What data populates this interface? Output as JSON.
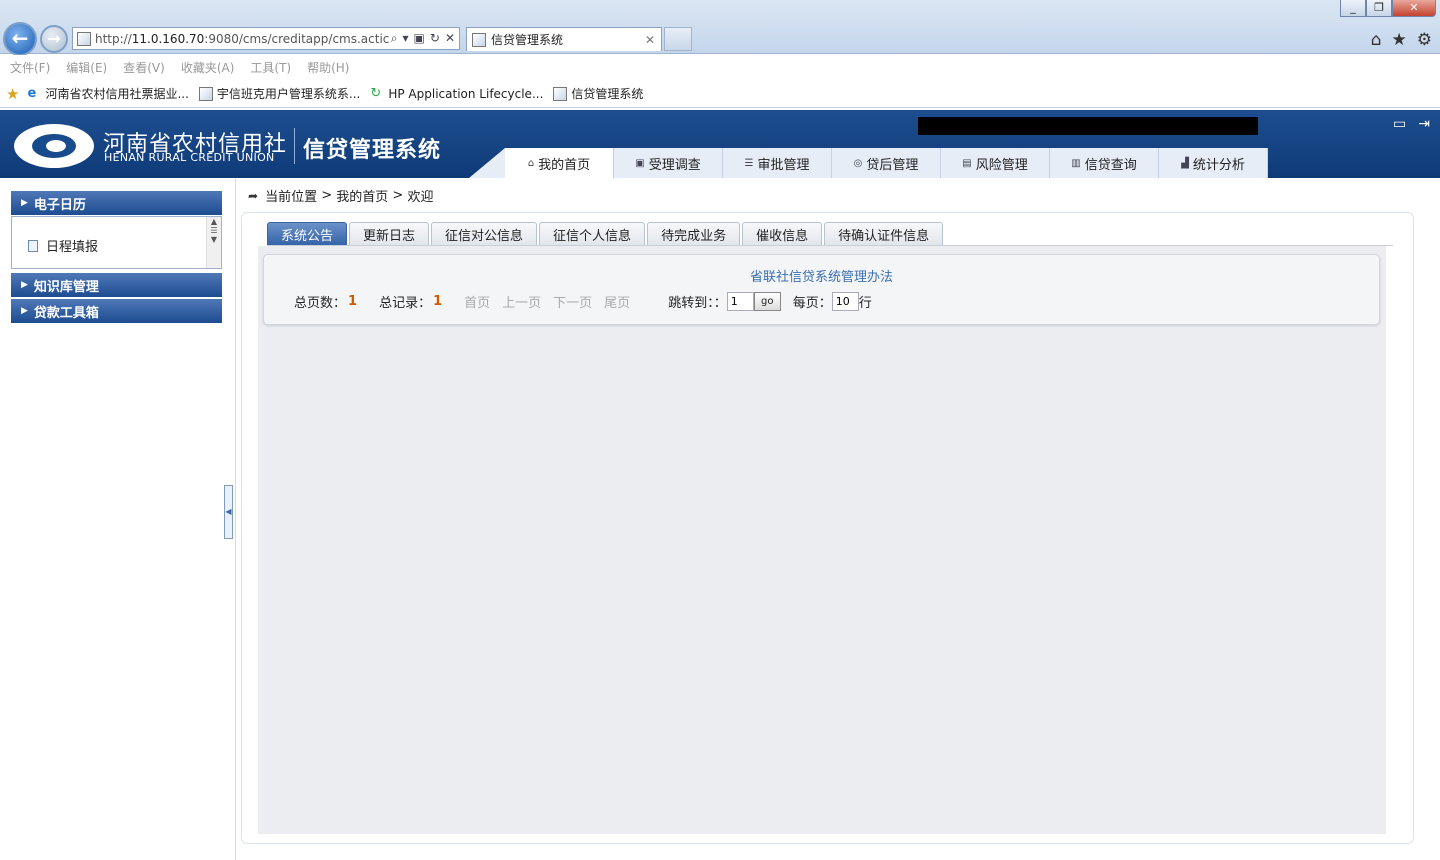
{
  "browser": {
    "address_prefix": "http://",
    "address_host": "11.0.160.70",
    "address_rest": ":9080/cms/creditapp/cms.actic",
    "tab_title": "信贷管理系统",
    "window_controls": [
      "_",
      "❐",
      "✕"
    ],
    "menu": [
      "文件(F)",
      "编辑(E)",
      "查看(V)",
      "收藏夹(A)",
      "工具(T)",
      "帮助(H)"
    ],
    "favorites": [
      "河南省农村信用社票据业...",
      "宇信班克用户管理系统系...",
      "HP Application Lifecycle...",
      "信贷管理系统"
    ]
  },
  "header": {
    "org_cn": "河南省农村信用社",
    "org_en": "HENAN RURAL CREDIT UNION",
    "system_name": "信贷管理系统"
  },
  "nav": [
    "我的首页",
    "受理调查",
    "审批管理",
    "贷后管理",
    "风险管理",
    "信贷查询",
    "统计分析"
  ],
  "sidebar": {
    "sections": [
      "电子日历",
      "知识库管理",
      "贷款工具箱"
    ],
    "items": [
      "日程填报"
    ]
  },
  "breadcrumb": {
    "label": "当前位置",
    "sep": ">",
    "level1": "我的首页",
    "level2": "欢迎"
  },
  "tabs": [
    "系统公告",
    "更新日志",
    "征信对公信息",
    "征信个人信息",
    "待完成业务",
    "催收信息",
    "待确认证件信息"
  ],
  "notice": {
    "title": "省联社信贷系统管理办法"
  },
  "pager": {
    "total_pages_label": "总页数：",
    "total_pages": "1",
    "total_records_label": "总记录：",
    "total_records": "1",
    "first": "首页",
    "prev": "上一页",
    "next": "下一页",
    "last": "尾页",
    "jump_label": "跳转到：：",
    "jump_value": "1",
    "go": "go",
    "per_page_label": "每页：",
    "per_page_value": "10",
    "per_page_unit": "行"
  },
  "colors": {
    "header_bg": "#174b8e",
    "active_tab": "#3564a8",
    "pager_number": "#d05a00",
    "notice_link": "#3b6eb0"
  }
}
